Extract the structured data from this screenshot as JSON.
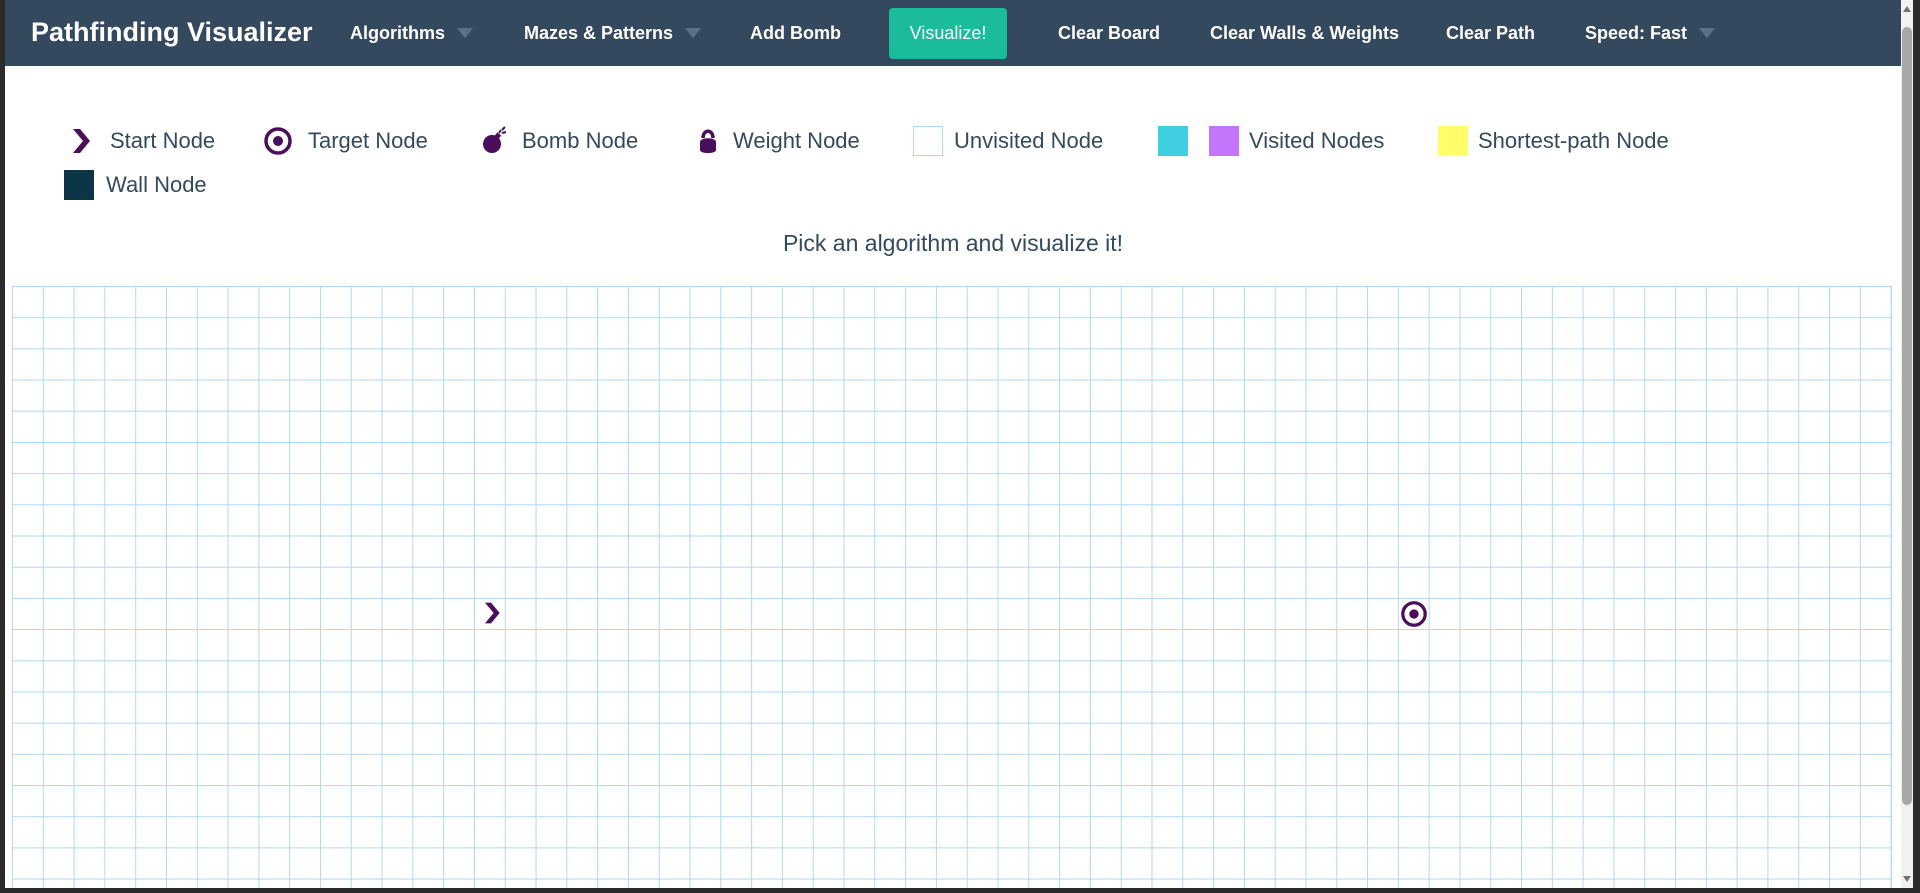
{
  "navbar": {
    "brand": "Pathfinding Visualizer",
    "algorithms": "Algorithms",
    "mazes": "Mazes & Patterns",
    "add_bomb": "Add Bomb",
    "visualize": "Visualize!",
    "clear_board": "Clear Board",
    "clear_walls": "Clear Walls & Weights",
    "clear_path": "Clear Path",
    "speed": "Speed: Fast"
  },
  "legend": {
    "start": "Start Node",
    "target": "Target Node",
    "bomb": "Bomb Node",
    "weight": "Weight Node",
    "unvisited": "Unvisited Node",
    "visited": "Visited Nodes",
    "shortest": "Shortest-path Node",
    "wall": "Wall Node"
  },
  "instructions": "Pick an algorithm and visualize it!",
  "colors": {
    "navbar": "#34495e",
    "visualize_button": "#1abc9c",
    "node_icon": "#4a0e5c",
    "visited_cyan": "#40cee3",
    "visited_purple": "#c375fb",
    "shortest_path": "#fffe6a",
    "wall": "#0c3547",
    "grid_line": "#afd8f8"
  },
  "icons": {
    "start": "chevron-right-icon",
    "target": "target-circle-icon",
    "bomb": "bomb-icon",
    "weight": "kettlebell-icon"
  }
}
